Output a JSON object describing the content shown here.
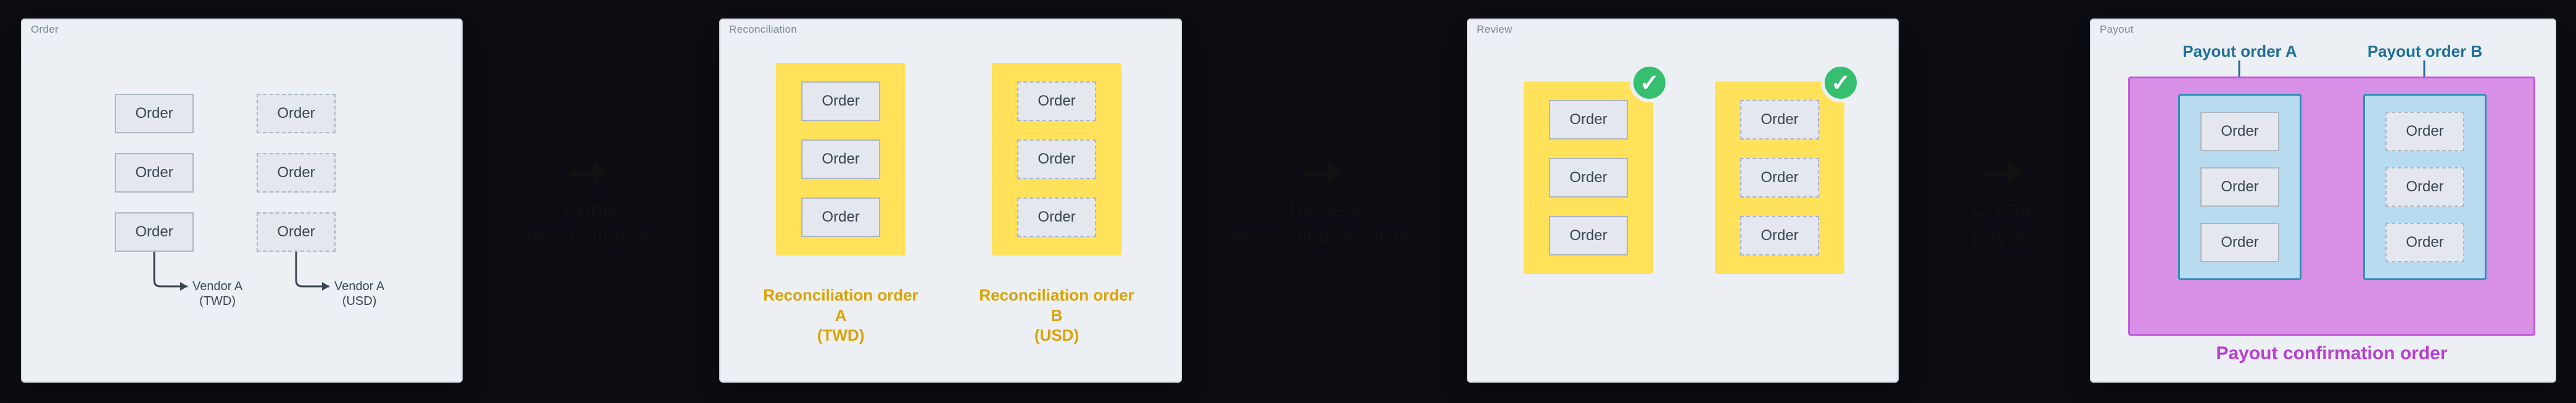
{
  "order_label": "Order",
  "stages": {
    "order": {
      "title": "Order",
      "vendorA": "Vendor A\n(TWD)",
      "vendorB": "Vendor A\n(USD)"
    },
    "recon": {
      "title": "Reconciliation",
      "capA": "Reconciliation order A\n(TWD)",
      "capB": "Reconciliation order B\n(USD)"
    },
    "review": {
      "title": "Review"
    },
    "payout": {
      "title": "Payout",
      "capA": "Payout order  A",
      "capB": "Payout order B",
      "bottom": "Payout confirmation order"
    }
  },
  "steps": {
    "s1": "Apply\nreconciliation",
    "s2": "Review\nreconciliation order",
    "s3": "Create\npayout"
  },
  "icons": {
    "arrow_right": "→",
    "check": "✓"
  }
}
